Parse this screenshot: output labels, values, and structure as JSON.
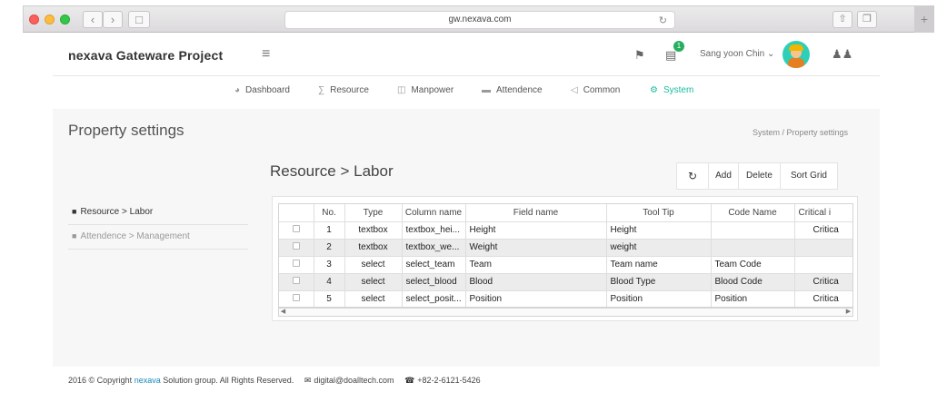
{
  "browser": {
    "url": "gw.nexava.com"
  },
  "header": {
    "brand": "nexava Gateware Project",
    "notification_count": "1",
    "user_name": "Sang yoon Chin ⌄"
  },
  "nav": [
    {
      "label": "Dashboard",
      "icon": "dashboard-icon"
    },
    {
      "label": "Resource",
      "icon": "resource-icon"
    },
    {
      "label": "Manpower",
      "icon": "manpower-icon"
    },
    {
      "label": "Attendence",
      "icon": "attendence-icon"
    },
    {
      "label": "Common",
      "icon": "common-icon"
    },
    {
      "label": "System",
      "icon": "gear-icon",
      "active": true
    }
  ],
  "page": {
    "title": "Property settings",
    "breadcrumb": "System  /  Property settings"
  },
  "sidebar": {
    "items": [
      {
        "label": "Resource > Labor",
        "active": true
      },
      {
        "label": "Attendence > Management",
        "active": false
      }
    ]
  },
  "grid": {
    "title": "Resource > Labor",
    "toolbar": {
      "add": "Add",
      "delete": "Delete",
      "sort": "Sort Grid"
    },
    "columns": [
      "No.",
      "Type",
      "Column name",
      "Field name",
      "Tool Tip",
      "Code Name",
      "Critical i"
    ],
    "rows": [
      [
        "1",
        "textbox",
        "textbox_hei...",
        "Height",
        "Height",
        "",
        "Critica"
      ],
      [
        "2",
        "textbox",
        "textbox_we...",
        "Weight",
        "weight",
        "",
        ""
      ],
      [
        "3",
        "select",
        "select_team",
        "Team",
        "Team name",
        "Team Code",
        ""
      ],
      [
        "4",
        "select",
        "select_blood",
        "Blood",
        "Blood Type",
        "Blood Code",
        "Critica"
      ],
      [
        "5",
        "select",
        "select_posit...",
        "Position",
        "Position",
        "Position",
        "Critica"
      ]
    ]
  },
  "footer": {
    "copyright_pre": "2016 © Copyright ",
    "copyright_brand": "nexava",
    "copyright_post": " Solution group. All Rights Reserved.",
    "email": "digital@doalltech.com",
    "phone": "+82-2-6121-5426"
  },
  "colors": {
    "accent": "#1abc9c",
    "badge": "#27ae60"
  }
}
